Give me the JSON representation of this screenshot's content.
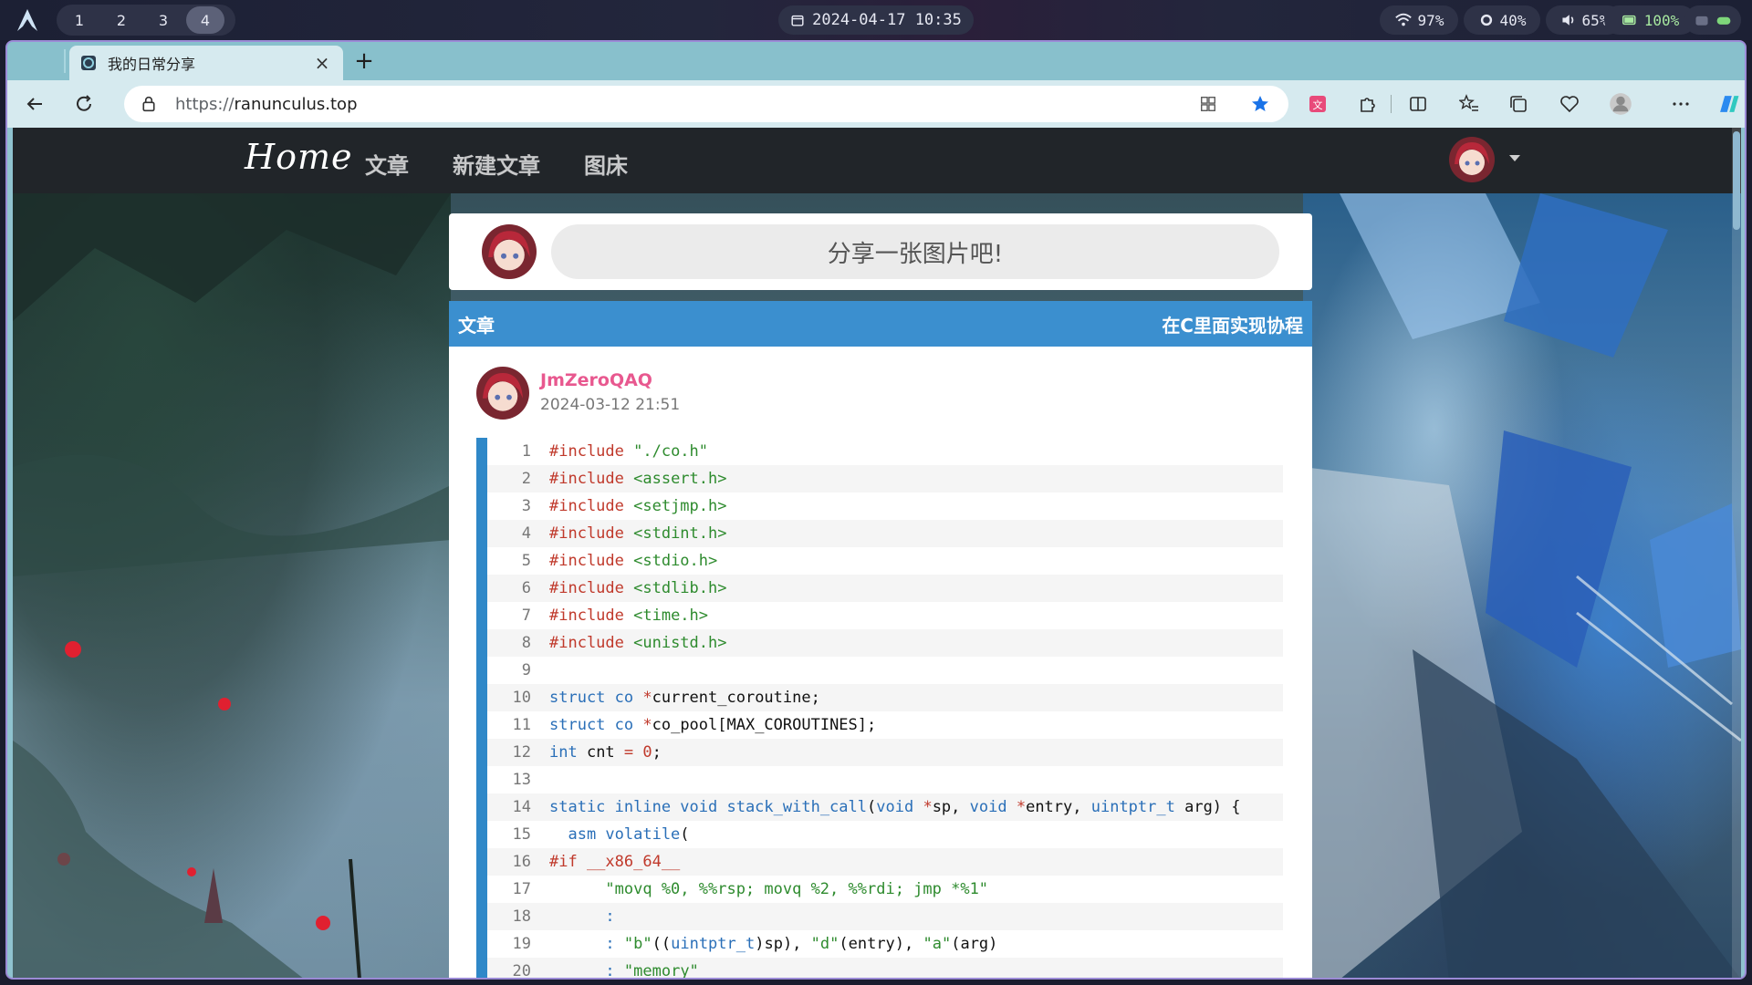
{
  "statusbar": {
    "workspaces": [
      "1",
      "2",
      "3",
      "4"
    ],
    "active_workspace": "4",
    "clock": "2024-04-17 10:35",
    "wifi": "97%",
    "brightness": "40%",
    "volume": "65%",
    "battery": "100%"
  },
  "browser": {
    "tab_title": "我的日常分享",
    "url_scheme": "https://",
    "url_host": "ranunculus.top"
  },
  "site": {
    "brand": "Home",
    "nav": [
      "文章",
      "新建文章",
      "图床"
    ]
  },
  "share": {
    "placeholder": "分享一张图片吧!"
  },
  "article": {
    "section_label": "文章",
    "title": "在C里面实现协程",
    "author": "JmZeroQAQ",
    "date": "2024-03-12 21:51"
  },
  "code_lines": [
    {
      "n": "1",
      "tokens": [
        [
          "pp",
          "#include "
        ],
        [
          "st",
          "\"./co.h\""
        ]
      ]
    },
    {
      "n": "2",
      "tokens": [
        [
          "pp",
          "#include "
        ],
        [
          "st",
          "<assert.h>"
        ]
      ]
    },
    {
      "n": "3",
      "tokens": [
        [
          "pp",
          "#include "
        ],
        [
          "st",
          "<setjmp.h>"
        ]
      ]
    },
    {
      "n": "4",
      "tokens": [
        [
          "pp",
          "#include "
        ],
        [
          "st",
          "<stdint.h>"
        ]
      ]
    },
    {
      "n": "5",
      "tokens": [
        [
          "pp",
          "#include "
        ],
        [
          "st",
          "<stdio.h>"
        ]
      ]
    },
    {
      "n": "6",
      "tokens": [
        [
          "pp",
          "#include "
        ],
        [
          "st",
          "<stdlib.h>"
        ]
      ]
    },
    {
      "n": "7",
      "tokens": [
        [
          "pp",
          "#include "
        ],
        [
          "st",
          "<time.h>"
        ]
      ]
    },
    {
      "n": "8",
      "tokens": [
        [
          "pp",
          "#include "
        ],
        [
          "st",
          "<unistd.h>"
        ]
      ]
    },
    {
      "n": "9",
      "tokens": []
    },
    {
      "n": "10",
      "tokens": [
        [
          "kw",
          "struct co "
        ],
        [
          "pp",
          "*"
        ],
        [
          "",
          "current_coroutine;"
        ]
      ]
    },
    {
      "n": "11",
      "tokens": [
        [
          "kw",
          "struct co "
        ],
        [
          "pp",
          "*"
        ],
        [
          "",
          "co_pool[MAX_COROUTINES];"
        ]
      ]
    },
    {
      "n": "12",
      "tokens": [
        [
          "kw",
          "int "
        ],
        [
          "",
          "cnt "
        ],
        [
          "pp",
          "= "
        ],
        [
          "nm",
          "0"
        ],
        [
          "",
          ";"
        ]
      ]
    },
    {
      "n": "13",
      "tokens": []
    },
    {
      "n": "14",
      "tokens": [
        [
          "kw",
          "static inline void "
        ],
        [
          "kw",
          "stack_with_call"
        ],
        [
          "",
          "("
        ],
        [
          "kw",
          "void "
        ],
        [
          "pp",
          "*"
        ],
        [
          "",
          "sp, "
        ],
        [
          "kw",
          "void "
        ],
        [
          "pp",
          "*"
        ],
        [
          "",
          "entry, "
        ],
        [
          "kw",
          "uintptr_t "
        ],
        [
          "",
          "arg) {"
        ]
      ]
    },
    {
      "n": "15",
      "tokens": [
        [
          "kw",
          "  asm volatile"
        ],
        [
          "",
          "("
        ]
      ]
    },
    {
      "n": "16",
      "tokens": [
        [
          "pp",
          "#if __x86_64__"
        ]
      ]
    },
    {
      "n": "17",
      "tokens": [
        [
          "st",
          "      \"movq %0, %%rsp; movq %2, %%rdi; jmp *%1\""
        ]
      ]
    },
    {
      "n": "18",
      "tokens": [
        [
          "",
          "      "
        ],
        [
          "kw",
          ":"
        ]
      ]
    },
    {
      "n": "19",
      "tokens": [
        [
          "",
          "      "
        ],
        [
          "kw",
          ": "
        ],
        [
          "st",
          "\"b\""
        ],
        [
          "",
          "(("
        ],
        [
          "kw",
          "uintptr_t"
        ],
        [
          "",
          ")sp), "
        ],
        [
          "st",
          "\"d\""
        ],
        [
          "",
          "(entry), "
        ],
        [
          "st",
          "\"a\""
        ],
        [
          "",
          "(arg)"
        ]
      ]
    },
    {
      "n": "20",
      "tokens": [
        [
          "",
          "      "
        ],
        [
          "kw",
          ": "
        ],
        [
          "st",
          "\"memory\""
        ]
      ]
    }
  ],
  "colors": {
    "navbar": "#212529",
    "article_header": "#3b8fcf",
    "author_name": "#e8588f",
    "code_bar": "#2f88c8"
  }
}
